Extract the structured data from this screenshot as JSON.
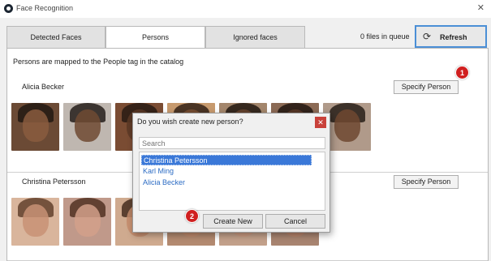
{
  "window": {
    "title": "Face Recognition",
    "close_glyph": "✕"
  },
  "tabs": [
    {
      "label": "Detected Faces",
      "active": false
    },
    {
      "label": "Persons",
      "active": true
    },
    {
      "label": "Ignored faces",
      "active": false
    }
  ],
  "queue_status": "0 files in queue",
  "refresh": {
    "label": "Refresh",
    "icon": "refresh-icon",
    "accent": "#4b8fd6"
  },
  "panel": {
    "info": "Persons are mapped to the People tag in the catalog",
    "persons": [
      {
        "name": "Alicia Becker",
        "specify_label": "Specify Person"
      },
      {
        "name": "Christina Petersson",
        "specify_label": "Specify Person"
      }
    ]
  },
  "callouts": [
    "1",
    "2"
  ],
  "callout_color": "#d01f1f",
  "dialog": {
    "title": "Do you wish create new person?",
    "close_glyph": "✕",
    "search_placeholder": "Search",
    "items": [
      {
        "label": "Christina Petersson",
        "selected": true
      },
      {
        "label": "Karl Ming",
        "selected": false
      },
      {
        "label": "Alicia Becker",
        "selected": false
      }
    ],
    "create_label": "Create New",
    "cancel_label": "Cancel"
  }
}
